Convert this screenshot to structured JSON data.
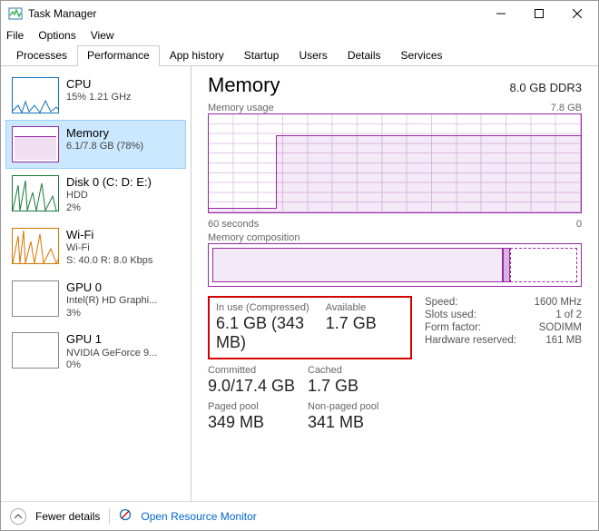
{
  "window": {
    "title": "Task Manager"
  },
  "menu": {
    "file": "File",
    "options": "Options",
    "view": "View"
  },
  "tabs": [
    "Processes",
    "Performance",
    "App history",
    "Startup",
    "Users",
    "Details",
    "Services"
  ],
  "activeTab": 1,
  "sidebar": {
    "items": [
      {
        "title": "CPU",
        "line1": "15%  1.21 GHz",
        "line2": ""
      },
      {
        "title": "Memory",
        "line1": "6.1/7.8 GB (78%)",
        "line2": ""
      },
      {
        "title": "Disk 0 (C: D: E:)",
        "line1": "HDD",
        "line2": "2%"
      },
      {
        "title": "Wi-Fi",
        "line1": "Wi-Fi",
        "line2": "S: 40.0  R: 8.0 Kbps"
      },
      {
        "title": "GPU 0",
        "line1": "Intel(R) HD Graphi...",
        "line2": "3%"
      },
      {
        "title": "GPU 1",
        "line1": "NVIDIA GeForce 9...",
        "line2": "0%"
      }
    ],
    "selected": 1
  },
  "header": {
    "title": "Memory",
    "capacity": "8.0 GB DDR3"
  },
  "usageChart": {
    "label": "Memory usage",
    "rightLabel": "7.8 GB",
    "axisLeft": "60 seconds",
    "axisRight": "0"
  },
  "compChart": {
    "label": "Memory composition"
  },
  "stats": {
    "inUseLabel": "In use (Compressed)",
    "availableLabel": "Available",
    "inUse": "6.1 GB (343 MB)",
    "available": "1.7 GB",
    "committedLabel": "Committed",
    "cachedLabel": "Cached",
    "committed": "9.0/17.4 GB",
    "cached": "1.7 GB",
    "pagedLabel": "Paged pool",
    "nonpagedLabel": "Non-paged pool",
    "paged": "349 MB",
    "nonpaged": "341 MB"
  },
  "right": {
    "speedLabel": "Speed:",
    "speed": "1600 MHz",
    "slotsLabel": "Slots used:",
    "slots": "1 of 2",
    "formLabel": "Form factor:",
    "form": "SODIMM",
    "hwLabel": "Hardware reserved:",
    "hw": "161 MB"
  },
  "footer": {
    "fewer": "Fewer details",
    "resmon": "Open Resource Monitor"
  },
  "chart_data": {
    "type": "line",
    "title": "Memory usage",
    "ylabel": "GB",
    "ylim": [
      0,
      7.8
    ],
    "x": "seconds ago (60→0)",
    "series": [
      {
        "name": "Memory usage (GB)",
        "values": [
          0.3,
          0.3,
          0.3,
          0.3,
          6.0,
          6.1,
          6.1,
          6.1,
          6.1,
          6.1,
          6.1,
          6.1,
          6.1,
          6.1,
          6.1,
          6.1
        ]
      }
    ],
    "composition": {
      "in_use_gb": 6.1,
      "compressed_mb": 343,
      "available_gb": 1.7,
      "total_gb": 7.8
    }
  }
}
